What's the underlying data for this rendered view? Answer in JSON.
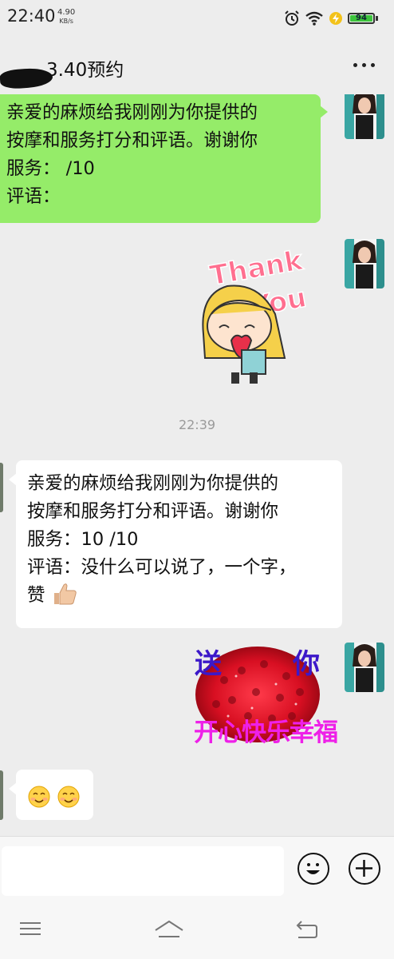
{
  "status_bar": {
    "time": "22:40",
    "net_speed_value": "4.90",
    "net_speed_unit": "KB/s",
    "battery": "94",
    "icons": [
      "alarm-icon",
      "wifi-icon",
      "charging-icon",
      "battery-icon"
    ]
  },
  "header": {
    "title": "3.40预约",
    "title_obscured_prefix": true
  },
  "messages": [
    {
      "side": "right",
      "type": "text",
      "lines": [
        "亲爱的麻烦给我刚刚为你提供的",
        "按摩和服务打分和评语。谢谢你",
        "服务：  /10",
        "评语："
      ]
    },
    {
      "side": "right",
      "type": "sticker",
      "sticker_text_1": "Thank",
      "sticker_text_2": "You"
    },
    {
      "type": "timestamp",
      "text": "22:39"
    },
    {
      "side": "left",
      "type": "text",
      "lines": [
        "亲爱的麻烦给我刚刚为你提供的",
        "按摩和服务打分和评语。谢谢你",
        "服务：10 /10",
        "评语：没什么可以说了，一个字，",
        "赞"
      ],
      "emoji": "thumbs-up-icon"
    },
    {
      "side": "right",
      "type": "sticker",
      "sticker_text_top_left": "送",
      "sticker_text_top_right": "你",
      "sticker_text_bottom": "开心快乐幸福"
    },
    {
      "side": "left",
      "type": "emoji",
      "emoji": [
        "smiling-face-icon",
        "smiling-face-icon"
      ]
    }
  ],
  "input_bar": {
    "placeholder": "",
    "emoji_button_icon": "emoji-icon",
    "more_button_icon": "plus-icon"
  },
  "nav_bar": {
    "icons": [
      "menu-icon",
      "home-icon",
      "back-icon"
    ]
  },
  "colors": {
    "background": "#ededed",
    "sent_bubble": "#95ec69",
    "received_bubble": "#ffffff",
    "battery_fill": "#3cc43c"
  }
}
